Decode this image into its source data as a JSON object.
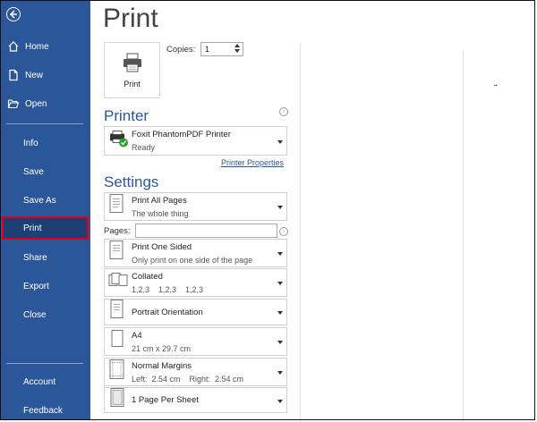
{
  "sidebar": {
    "items": [
      {
        "label": "Home",
        "icon": "home-icon"
      },
      {
        "label": "New",
        "icon": "new-document-icon"
      },
      {
        "label": "Open",
        "icon": "folder-open-icon"
      },
      {
        "label": "Info"
      },
      {
        "label": "Save"
      },
      {
        "label": "Save As"
      },
      {
        "label": "Print",
        "selected": true
      },
      {
        "label": "Share"
      },
      {
        "label": "Export"
      },
      {
        "label": "Close"
      },
      {
        "label": "Account"
      },
      {
        "label": "Feedback"
      }
    ]
  },
  "main": {
    "title": "Print",
    "print_button_label": "Print",
    "copies_label": "Copies:",
    "copies_value": "1",
    "printer_heading": "Printer",
    "printer": {
      "name": "Foxit PhantomPDF Printer",
      "status": "Ready"
    },
    "printer_properties_link": "Printer Properties",
    "settings_heading": "Settings",
    "pages_label": "Pages:",
    "settings": [
      {
        "title": "Print All Pages",
        "subtitle": "The whole thing"
      },
      {
        "title": "Print One Sided",
        "subtitle": "Only print on one side of the page"
      },
      {
        "title": "Collated",
        "subtitle": "1,2,3    1,2,3    1,2,3"
      },
      {
        "title": "Portrait Orientation",
        "subtitle": ""
      },
      {
        "title": "A4",
        "subtitle": "21 cm x 29.7 cm"
      },
      {
        "title": "Normal Margins",
        "subtitle": "Left:  2.54 cm    Right:  2.54 cm"
      },
      {
        "title": "1 Page Per Sheet",
        "subtitle": ""
      }
    ]
  },
  "colors": {
    "sidebar": "#2b579a",
    "selected_outline": "#e0001b",
    "accent": "#2b579a"
  }
}
